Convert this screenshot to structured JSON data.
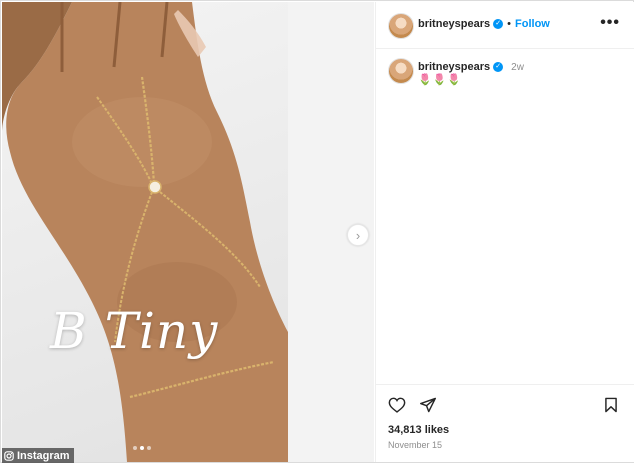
{
  "post": {
    "username": "britneyspears",
    "follow_label": "Follow",
    "bullet": "•",
    "more_label": "•••",
    "comment_username": "britneyspears",
    "comment_time": "2w",
    "caption": "🌷🌷🌷",
    "likes": "34,813 likes",
    "date": "November 15"
  },
  "media": {
    "overlay_text": "B Tiny",
    "slides_total": 3,
    "active_slide": 2,
    "next_symbol": "›"
  },
  "watermark": {
    "label": "Instagram"
  },
  "colors": {
    "link_blue": "#0095f6",
    "secondary_text": "#8e8e8e",
    "border": "#dbdbdb",
    "chain_gold": "#c79c5a"
  }
}
